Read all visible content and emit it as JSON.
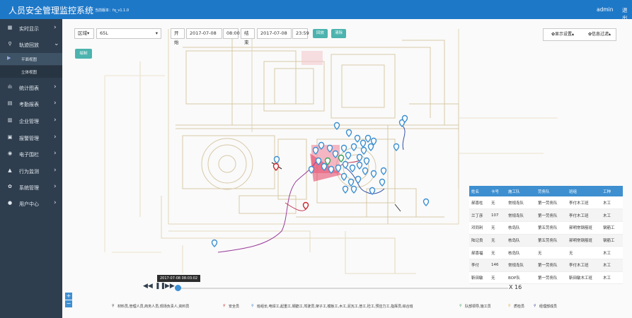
{
  "app": {
    "title": "人员安全管理监控系统",
    "version": "当前版本：fq_v1.1.0",
    "user": "admin",
    "logout": "退出"
  },
  "sidebar": {
    "items": [
      {
        "icon": "grid-icon",
        "glyph": "▦",
        "label": "实时显示",
        "arrow": "›"
      },
      {
        "icon": "location-icon",
        "glyph": "⚲",
        "label": "轨迹回放",
        "arrow": "⌄"
      },
      {
        "icon": "chart-icon",
        "glyph": "ılı",
        "label": "统计图表",
        "arrow": "›"
      },
      {
        "icon": "report-icon",
        "glyph": "▤",
        "label": "考勤报表",
        "arrow": "›"
      },
      {
        "icon": "building-icon",
        "glyph": "▥",
        "label": "企业管理",
        "arrow": "›"
      },
      {
        "icon": "alarm-icon",
        "glyph": "▣",
        "label": "报警管理",
        "arrow": "›"
      },
      {
        "icon": "fence-icon",
        "glyph": "◉",
        "label": "电子围栏",
        "arrow": "›"
      },
      {
        "icon": "warning-icon",
        "glyph": "▲",
        "label": "行为监测",
        "arrow": "›"
      },
      {
        "icon": "gear-icon",
        "glyph": "✿",
        "label": "系统管理",
        "arrow": "›"
      },
      {
        "icon": "user-icon",
        "glyph": "●",
        "label": "用户中心",
        "arrow": "›"
      }
    ],
    "subitems": [
      "平面视图",
      "立体视图"
    ]
  },
  "toolbar": {
    "area_label": "区域▾",
    "area_value": "65L",
    "area_arrow": "▾",
    "start_label": "开始",
    "start_date": "2017-07-08",
    "start_time": "08:00",
    "end_label": "结束",
    "end_date": "2017-07-08",
    "end_time": "23:59",
    "replay": "回放",
    "clear": "清除",
    "draw": "绘制",
    "display_settings": "✿显示设置▴",
    "info_filter": "✿信息过滤▴"
  },
  "table": {
    "headers": [
      "姓名",
      "卡号",
      "施工队",
      "劳务队",
      "班组",
      "工种"
    ],
    "rows": [
      [
        "郝喜柱",
        "无",
        "常规岛队",
        "第一劳务队",
        "李付木工班",
        "木工"
      ],
      [
        "兰丁彦",
        "107",
        "常规岛队",
        "第一劳务队",
        "李付木工班",
        "木工"
      ],
      [
        "邓同利",
        "无",
        "核岛队",
        "第五劳务队",
        "郝明常钢筋班",
        "钢筋工"
      ],
      [
        "陆记良",
        "无",
        "核岛队",
        "第五劳务队",
        "郝明常钢筋班",
        "钢筋工"
      ],
      [
        "郝喜福",
        "无",
        "核岛队",
        "无",
        "无",
        "木工"
      ],
      [
        "李付",
        "146",
        "常规岛队",
        "第一劳务队",
        "李付木工班",
        "木工"
      ],
      [
        "靳田敏",
        "无",
        "BOP队",
        "第一劳务队",
        "靳田敏木工班",
        "木工"
      ]
    ]
  },
  "playback": {
    "timestamp": "2017-07-08 08:03:02",
    "speed": "X 16",
    "progress": 0.0,
    "rewind": "◀◀",
    "pause": "❚❚",
    "forward": "▶▶"
  },
  "zoom": {
    "in": "+",
    "out": "−"
  },
  "legend": {
    "items": [
      {
        "text": "材料员,管理人员,商务人员,现场负责人,资料员",
        "color": "#333333"
      },
      {
        "text": "安全员",
        "color": "#c8282d"
      },
      {
        "text": "班组长,电焊工,起重工,钢筋工,驾驶员,架子工,模板工,木工,泥瓦工,普工,砼工,预应力工,指挥员,综合班",
        "color": "#3d7ad1"
      },
      {
        "text": "队部领导,施工员",
        "color": "#3aa05a"
      },
      {
        "text": "质检员",
        "color": "#e0a82e"
      },
      {
        "text": "经理部成员",
        "color": "#324b8e"
      }
    ]
  },
  "colors": {
    "topbar": "#1e78c8",
    "sidebar": "#2f3e4e",
    "accent": "#4cb3ae",
    "table_header": "#3d8fd0"
  }
}
